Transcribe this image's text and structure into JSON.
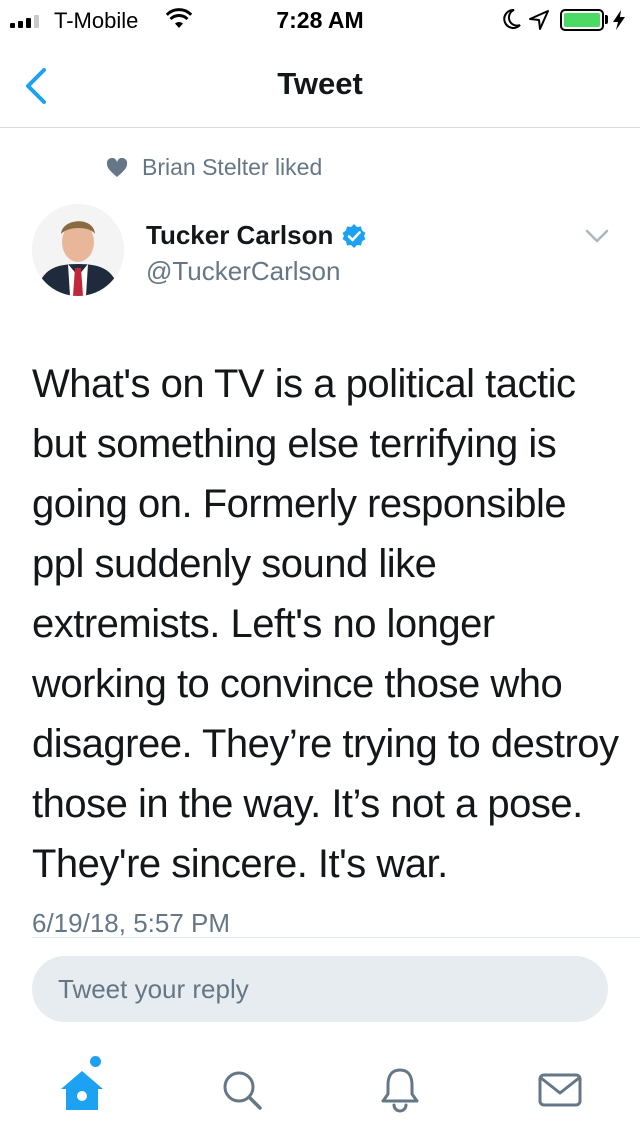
{
  "status_bar": {
    "carrier": "T-Mobile",
    "time": "7:28 AM",
    "battery_level": 1.0,
    "battery_color": "#4cd964"
  },
  "nav": {
    "title": "Tweet",
    "back_icon": "chevron-left-icon",
    "accent_color": "#1da1f2"
  },
  "social_context": {
    "icon": "heart-icon",
    "text": "Brian Stelter liked"
  },
  "tweet": {
    "author_name": "Tucker Carlson",
    "verified": true,
    "handle": "@TuckerCarlson",
    "text": "What's on TV is a political tactic but something else terrifying is going on. Formerly responsible ppl suddenly sound like extremists. Left's no longer working to convince those who disagree. They’re trying to destroy those in the way. It’s not a pose. They're sincere. It's war.",
    "timestamp": "6/19/18, 5:57 PM"
  },
  "reply": {
    "placeholder": "Tweet your reply"
  },
  "tab_bar": {
    "items": [
      {
        "icon": "home-icon",
        "active": true,
        "has_badge": true
      },
      {
        "icon": "search-icon",
        "active": false
      },
      {
        "icon": "bell-icon",
        "active": false
      },
      {
        "icon": "envelope-icon",
        "active": false
      }
    ]
  }
}
